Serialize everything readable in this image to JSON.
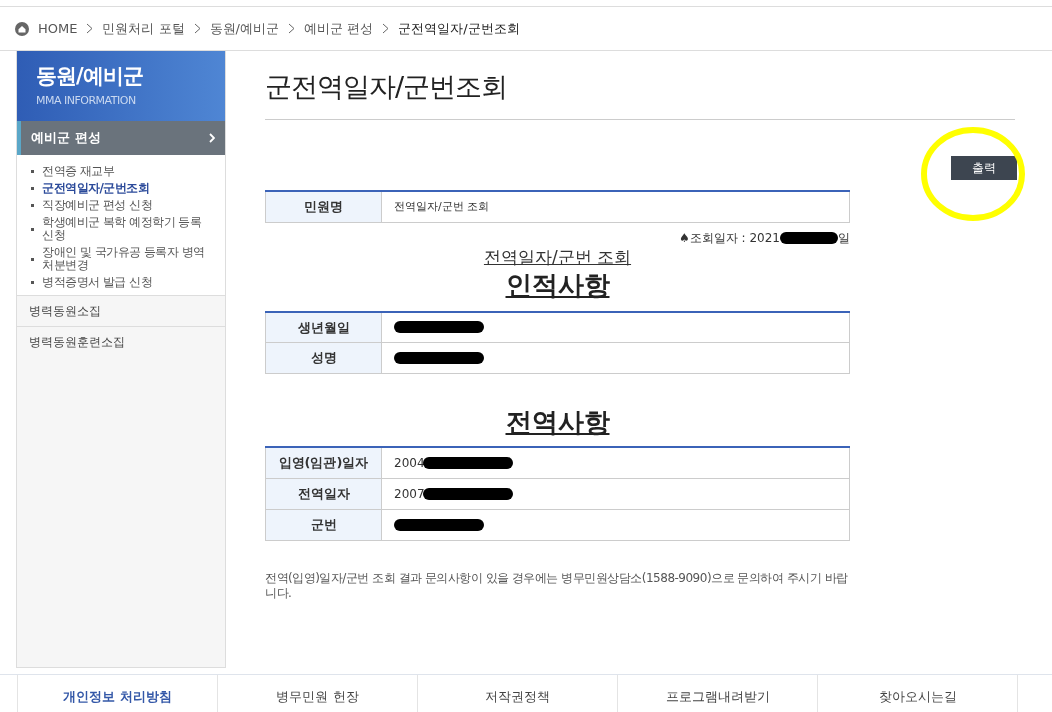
{
  "breadcrumb": {
    "items": [
      "HOME",
      "민원처리 포털",
      "동원/예비군",
      "예비군 편성",
      "군전역일자/군번조회"
    ]
  },
  "sidebar": {
    "title": "동원/예비군",
    "subtitle": "MMA INFORMATION",
    "active_section": "예비군 편성",
    "items": [
      {
        "label": "전역증 재교부",
        "selected": false
      },
      {
        "label": "군전역일자/군번조회",
        "selected": true
      },
      {
        "label": "직장예비군 편성 신청",
        "selected": false
      },
      {
        "label": "학생예비군 복학 예정학기 등록 신청",
        "selected": false
      },
      {
        "label": "장애인 및 국가유공 등록자 병역 처분변경",
        "selected": false
      },
      {
        "label": "병적증명서 발급 신청",
        "selected": false
      }
    ],
    "sections": [
      "병력동원소집",
      "병력동원훈련소집"
    ]
  },
  "page_title": "군전역일자/군번조회",
  "print_button": "출력",
  "request": {
    "label": "민원명",
    "value": "전역일자/군번 조회"
  },
  "inquiry_date": {
    "prefix": "♠조회일자 : 2021",
    "suffix": "일"
  },
  "report_title": "전역일자/군번 조회",
  "personal": {
    "heading": "인적사항",
    "rows": [
      {
        "label": "생년월일",
        "value": ""
      },
      {
        "label": "성명",
        "value": ""
      }
    ]
  },
  "service": {
    "heading": "전역사항",
    "rows": [
      {
        "label": "입영(임관)일자",
        "value": "2004"
      },
      {
        "label": "전역일자",
        "value": "2007"
      },
      {
        "label": "군번",
        "value": ""
      }
    ]
  },
  "notice": "전역(입영)일자/군번 조회 결과 문의사항이 있을 경우에는 병무민원상담소(1588-9090)으로 문의하여 주시기 바랍니다.",
  "footer": [
    {
      "label": "개인정보 처리방침",
      "selected": true
    },
    {
      "label": "병무민원 헌장",
      "selected": false
    },
    {
      "label": "저작권정책",
      "selected": false
    },
    {
      "label": "프로그램내려받기",
      "selected": false
    },
    {
      "label": "찾아오시는길",
      "selected": false
    }
  ]
}
